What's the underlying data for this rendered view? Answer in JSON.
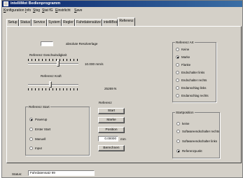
{
  "window": {
    "title": "intelliMot Bedienprogramm"
  },
  "menu": [
    {
      "underline": "K",
      "rest": "onfiguration"
    },
    {
      "underline": "I",
      "rest": "nfo"
    },
    {
      "underline": "S",
      "rest": "tsg"
    },
    {
      "underline": "S",
      "rest": "tat fG"
    },
    {
      "underline": "E",
      "rest": "instrlicht"
    },
    {
      "underline": "S",
      "rest": "ave"
    }
  ],
  "tabs": [
    "Setup",
    "Status",
    "Service",
    "System",
    "Regler",
    "Fahrdatensätze",
    "intelliBox",
    "Referenz"
  ],
  "active_tab": "Referenz",
  "abs_res_label": "absolute Resolverlage",
  "speed": {
    "label": "Referenz Geschwindigkeit",
    "value": "10.000 mm/s",
    "level": 0.6
  },
  "force": {
    "label": "Referenz Kraft",
    "value": "25269 N",
    "level": 0.45
  },
  "ref_start": {
    "title": "Referenz Start",
    "options": [
      "Powerup",
      "Erster Start",
      "Manuell",
      "Input"
    ],
    "selected": "Powerup"
  },
  "referenz": {
    "title": "Referenz",
    "start_label": "Start",
    "marke_label": "Marke",
    "position_label": "Position",
    "position_value": "0.00000",
    "position_unit": "mm",
    "bearbeiten_label": "Berechnen"
  },
  "ref_art": {
    "title": "Referenz Art",
    "options": [
      "Keine",
      "Marke",
      "Flanke",
      "Endschalter links",
      "Endschalter rechts",
      "Endanschlag links",
      "Endanschlag rechts"
    ],
    "selected": "Marke"
  },
  "startposition": {
    "title": "Startposition",
    "options": [
      "keine",
      "Softwareendschalter rechts",
      "Softwareendschalter links",
      "Referenzpunkt"
    ],
    "selected": "Referenzpunkt"
  },
  "status": {
    "label": "Status:",
    "value": "Fahrdatensatz 99"
  }
}
